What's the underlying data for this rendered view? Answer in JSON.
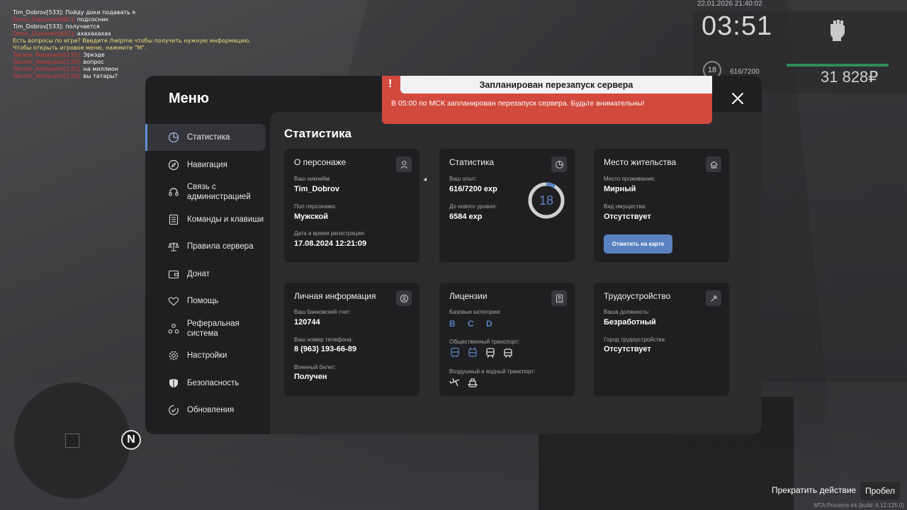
{
  "chat": [
    {
      "name": "Tim_Dobrov[533]:",
      "name_color": "white",
      "text": "Пойду доки подавать я"
    },
    {
      "name": "Denis_Diakaven[682]:",
      "name_color": "red",
      "text": "подсосник"
    },
    {
      "name": "Tim_Dobrov[533]:",
      "name_color": "white",
      "text": "получается"
    },
    {
      "name": "Denis_Diakaven[682]:",
      "name_color": "red",
      "text": "ахахахахах"
    },
    {
      "name": "",
      "name_color": "yellow",
      "text": "Есть вопросы по игре? Введите /helpme чтобы получить нужную информацию."
    },
    {
      "name": "",
      "name_color": "yellow",
      "text": "Чтобы открыть игровое меню, нажмите \"M\"."
    },
    {
      "name": "Takumi_Kobayashi[135]:",
      "name_color": "red",
      "text": "Эркэде"
    },
    {
      "name": "Takumi_Kobayashi[135]:",
      "name_color": "red",
      "text": "вопрос"
    },
    {
      "name": "Takumi_Kobayashi[135]:",
      "name_color": "red",
      "text": "на миллион"
    },
    {
      "name": "Takumi_Kobayashi[135]:",
      "name_color": "red",
      "text": "вы татары?"
    }
  ],
  "hud": {
    "datetime": "22.01.2026 21:40:02",
    "clock": "03:51",
    "level": "18",
    "exp": "616/7200",
    "money": "31 828₽"
  },
  "menu": {
    "title": "Меню",
    "sidebar": [
      {
        "label": "Статистика",
        "icon": "pie-chart-icon",
        "active": true
      },
      {
        "label": "Навигация",
        "icon": "compass-icon"
      },
      {
        "label": "Связь с администрацией",
        "icon": "headset-icon"
      },
      {
        "label": "Команды и клавиши",
        "icon": "list-icon"
      },
      {
        "label": "Правила сервера",
        "icon": "scales-icon"
      },
      {
        "label": "Донат",
        "icon": "wallet-icon"
      },
      {
        "label": "Помощь",
        "icon": "handshake-icon"
      },
      {
        "label": "Реферальная система",
        "icon": "referral-icon"
      },
      {
        "label": "Настройки",
        "icon": "gear-icon"
      },
      {
        "label": "Безопасность",
        "icon": "shield-icon"
      },
      {
        "label": "Обновления",
        "icon": "refresh-check-icon"
      }
    ],
    "content_title": "Статистика",
    "cards": {
      "character": {
        "title": "О персонаже",
        "nick_label": "Ваш никнейм:",
        "nick": "Tim_Dobrov",
        "gender_label": "Пол персонажа:",
        "gender": "Мужской",
        "reg_label": "Дата и время регистрации:",
        "reg": "17.08.2024 12:21:09"
      },
      "stats": {
        "title": "Статистика",
        "exp_label": "Ваш опыт:",
        "exp": "616/7200 exp",
        "next_label": "До нового уровня:",
        "next": "6584 exp",
        "level": "18",
        "progress": 0.0856
      },
      "residence": {
        "title": "Место жительства",
        "place_label": "Место проживания:",
        "place": "Мирный",
        "property_label": "Вид имущества:",
        "property": "Отсутствует",
        "button": "Отметить на карте"
      },
      "personal": {
        "title": "Личная информация",
        "bank_label": "Ваш банковский счет:",
        "bank": "120744",
        "phone_label": "Ваш номер телефона:",
        "phone": "8 (963) 193-66-89",
        "military_label": "Военный билет:",
        "military": "Получен"
      },
      "licenses": {
        "title": "Лицензии",
        "base_label": "Базовые категории:",
        "base": "B C D",
        "public_label": "Общественный транспорт:",
        "air_label": "Воздушный и водный транспорт:"
      },
      "employment": {
        "title": "Трудоустройство",
        "position_label": "Ваша должность:",
        "position": "Безработный",
        "city_label": "Город трудоустройства:",
        "city": "Отсутствует"
      }
    }
  },
  "notification": {
    "title": "Запланирован перезапуск сервера",
    "text": "В 05:00 по МСК запланирован перезапуск сервера. Будьте внимательны!"
  },
  "minimap": {
    "north": "N"
  },
  "hint": {
    "cancel": "Прекратить действие",
    "key": "Пробел"
  },
  "build": "MTA:Province #4 (build: 6.12.125.0)",
  "colors": {
    "accent": "#5b82c0",
    "alert": "#d14a3d",
    "money_bar": "#2d8c5a"
  }
}
